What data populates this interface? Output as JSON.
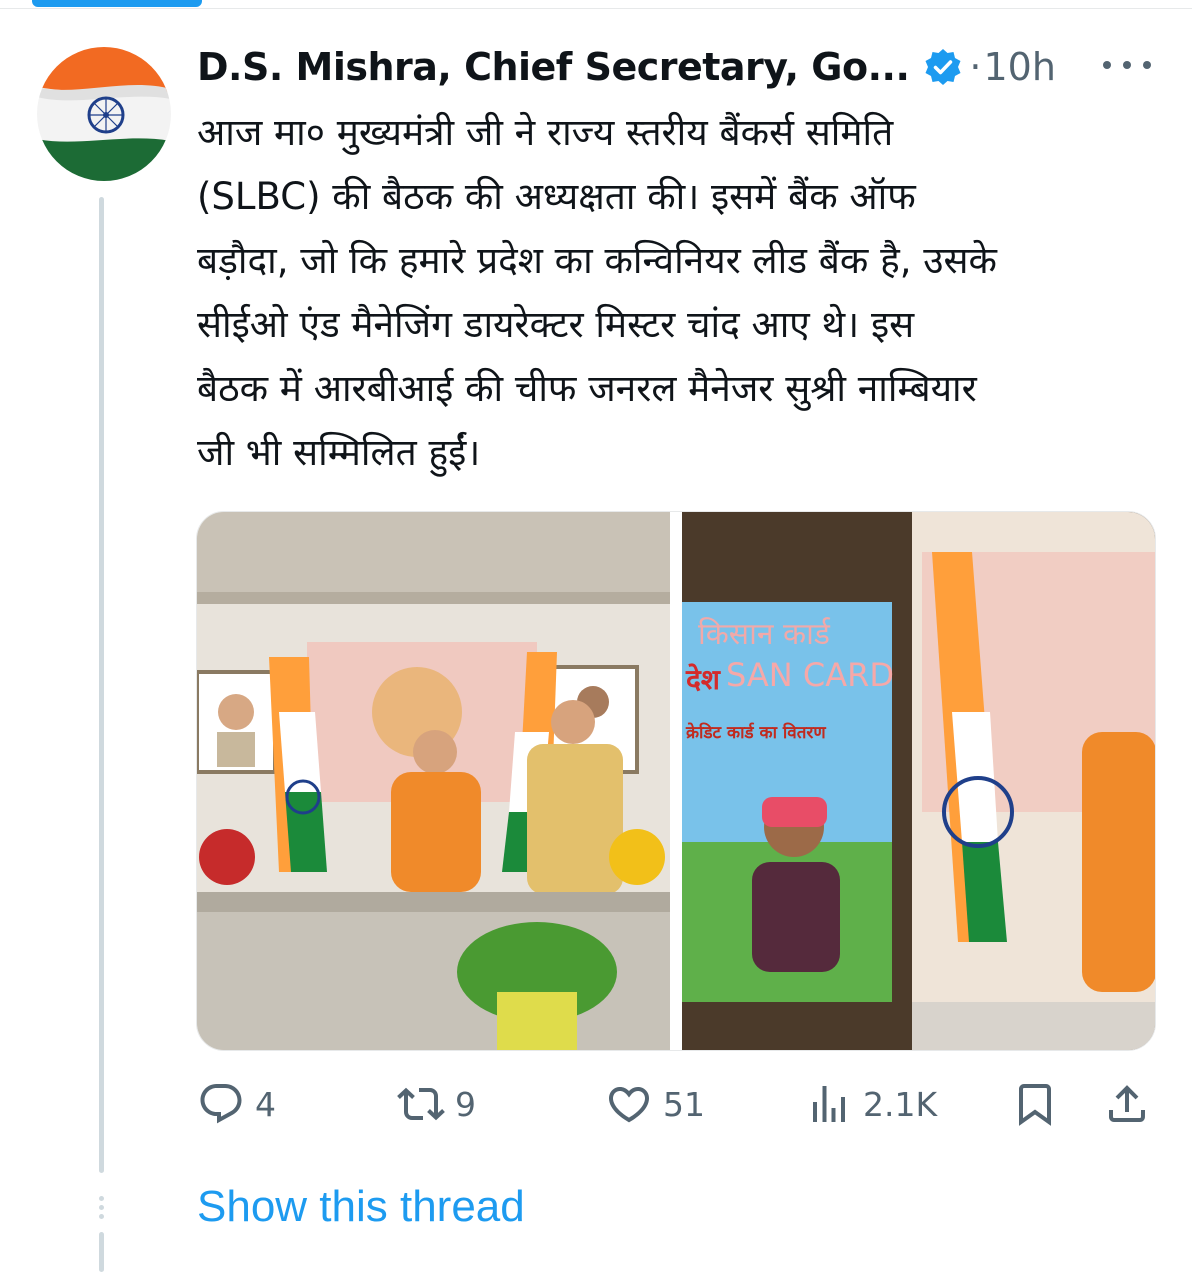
{
  "tweet": {
    "author_name": "D.S. Mishra, Chief Secretary, Go...",
    "separator": "·",
    "time": "10h",
    "verified_icon": "verified-badge-icon",
    "text_lines": [
      "आज मा० मुख्यमंत्री जी ने राज्य स्तरीय बैंकर्स समिति",
      "(SLBC) की बैठक की अध्यक्षता की। इसमें बैंक ऑफ",
      "बड़ौदा, जो कि हमारे प्रदेश का कन्विनियर लीड बैंक है, उसके",
      "सीईओ एंड मैनेजिंग डायरेक्टर मिस्टर चांद आए थे। इस",
      "बैठक में आरबीआई की चीफ जनरल मैनेजर सुश्री नाम्बियार",
      "जी भी सम्मिलित हुईं।"
    ],
    "media": {
      "screen_text_1": "किसान कार्ड",
      "screen_text_2": "देश",
      "screen_text_3": "SAN CARD",
      "screen_text_4": "क्रेडिट कार्ड का वितरण"
    },
    "actions": {
      "replies": "4",
      "retweets": "9",
      "likes": "51",
      "views": "2.1K"
    },
    "show_thread": "Show this thread"
  },
  "colors": {
    "accent": "#1d9bf0",
    "muted": "#536471",
    "text": "#0f1419",
    "thread_line": "#cfd9de"
  }
}
